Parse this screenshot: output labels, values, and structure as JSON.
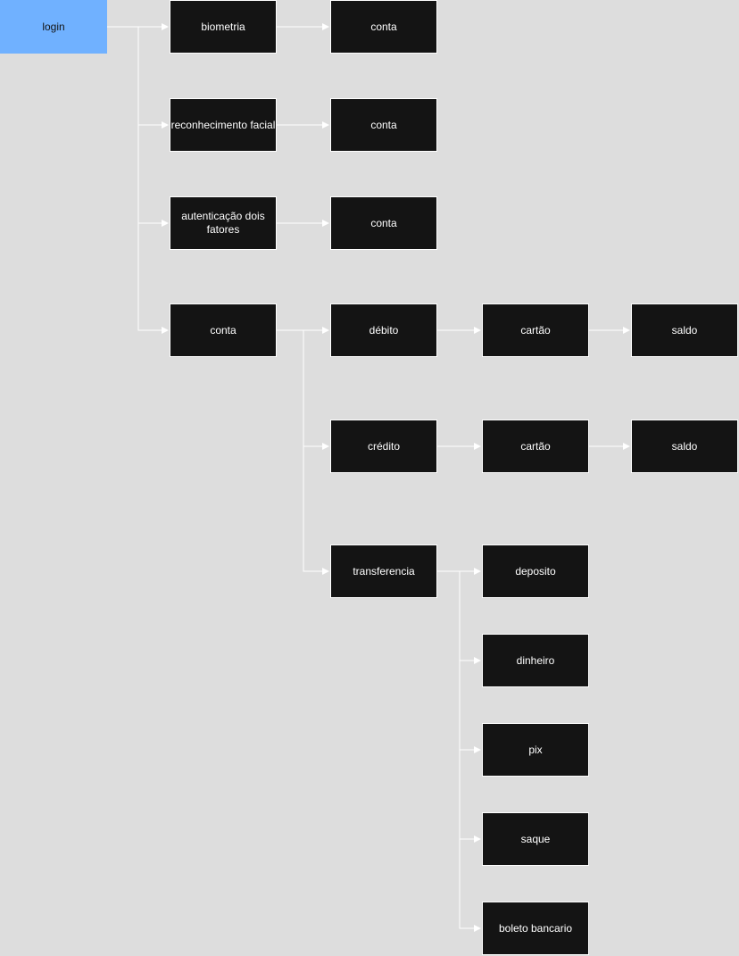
{
  "colors": {
    "background": "#dddddd",
    "node_dark": "#141414",
    "node_start": "#70b1ff",
    "edge": "#ffffff"
  },
  "nodes": {
    "login": "login",
    "biometria": "biometria",
    "conta_1": "conta",
    "reconhecimento_facial": "reconhecimento facial",
    "conta_2": "conta",
    "autenticacao_dois_fatores": "autenticação dois fatores",
    "conta_3": "conta",
    "conta_main": "conta",
    "debito": "débito",
    "cartao_debito": "cartão",
    "saldo_debito": "saldo",
    "credito": "crédito",
    "cartao_credito": "cartão",
    "saldo_credito": "saldo",
    "transferencia": "transferencia",
    "deposito": "deposito",
    "dinheiro": "dinheiro",
    "pix": "pix",
    "saque": "saque",
    "boleto_bancario": "boleto bancario"
  }
}
